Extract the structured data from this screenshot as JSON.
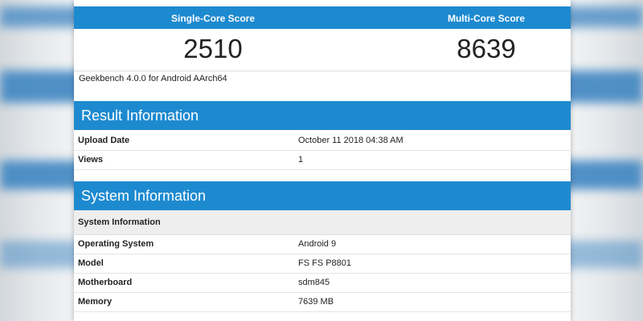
{
  "scores": {
    "single_label": "Single-Core Score",
    "multi_label": "Multi-Core Score",
    "single_value": "2510",
    "multi_value": "8639"
  },
  "version": "Geekbench 4.0.0 for Android AArch64",
  "result_info": {
    "title": "Result Information",
    "rows": [
      {
        "key": "Upload Date",
        "value": "October 11 2018 04:38 AM"
      },
      {
        "key": "Views",
        "value": "1"
      }
    ]
  },
  "system_info": {
    "title": "System Information",
    "subheader": "System Information",
    "rows": [
      {
        "key": "Operating System",
        "value": "Android 9"
      },
      {
        "key": "Model",
        "value": "FS FS P8801"
      },
      {
        "key": "Motherboard",
        "value": "sdm845"
      },
      {
        "key": "Memory",
        "value": "7639 MB"
      }
    ]
  },
  "colors": {
    "header_blue": "#1d8ad0",
    "text": "#222222"
  }
}
